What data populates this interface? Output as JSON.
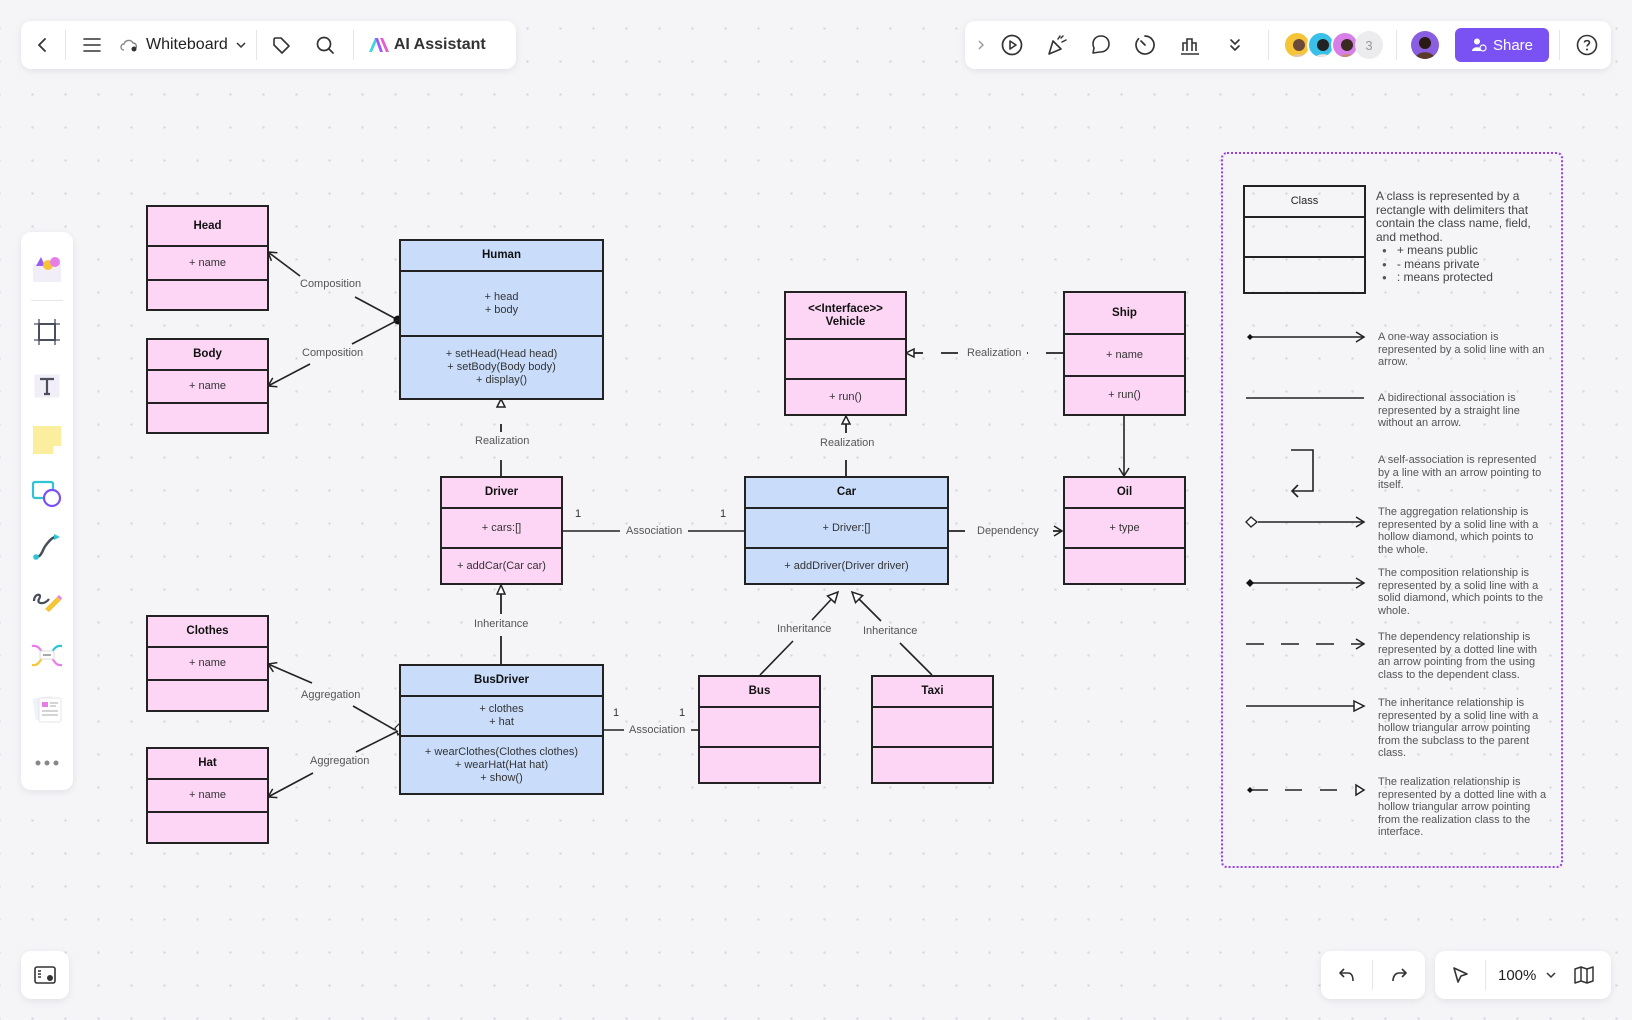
{
  "toolbar_left": {
    "back_icon": "chevron-left-icon",
    "menu_icon": "hamburger-icon",
    "cloud_icon": "cloud-icon",
    "title": "Whiteboard",
    "tag_icon": "tag-icon",
    "search_icon": "search-icon",
    "ai_label": "AI Assistant"
  },
  "toolbar_right": {
    "icons": [
      "chevron-right-icon",
      "play-icon",
      "celebrate-icon",
      "comment-icon",
      "timer-icon",
      "chart-icon",
      "double-chevron-down-icon"
    ],
    "collaborator_count": "3",
    "share_label": "Share",
    "help_icon": "help-icon"
  },
  "left_toolbar": {
    "items": [
      "templates",
      "frame",
      "text",
      "sticky-note",
      "shapes",
      "connector",
      "pen",
      "mindmap",
      "cards",
      "more"
    ]
  },
  "bottom": {
    "zoom_level": "100%"
  },
  "diagram": {
    "classes": {
      "head": {
        "name": "Head",
        "fields": [
          "+ name"
        ],
        "methods": []
      },
      "body": {
        "name": "Body",
        "fields": [
          "+ name"
        ],
        "methods": []
      },
      "human": {
        "name": "Human",
        "fields": [
          "+ head",
          "+ body"
        ],
        "methods": [
          "+ setHead(Head head)",
          "+ setBody(Body body)",
          "+ display()"
        ]
      },
      "driver": {
        "name": "Driver",
        "fields": [
          "+ cars:[]"
        ],
        "methods": [
          "+ addCar(Car car)"
        ]
      },
      "clothes": {
        "name": "Clothes",
        "fields": [
          "+ name"
        ],
        "methods": []
      },
      "hat": {
        "name": "Hat",
        "fields": [
          "+ name"
        ],
        "methods": []
      },
      "busdriver": {
        "name": "BusDriver",
        "fields": [
          "+ clothes",
          "+ hat"
        ],
        "methods": [
          "+ wearClothes(Clothes clothes)",
          "+ wearHat(Hat hat)",
          "+ show()"
        ]
      },
      "vehicle": {
        "name_line1": "<<Interface>>",
        "name_line2": "Vehicle",
        "fields": [],
        "methods": [
          "+ run()"
        ]
      },
      "car": {
        "name": "Car",
        "fields": [
          "+ Driver:[]"
        ],
        "methods": [
          "+ addDriver(Driver driver)"
        ]
      },
      "bus": {
        "name": "Bus",
        "fields": [],
        "methods": []
      },
      "taxi": {
        "name": "Taxi",
        "fields": [],
        "methods": []
      },
      "ship": {
        "name": "Ship",
        "fields": [
          "+ name"
        ],
        "methods": [
          "+ run()"
        ]
      },
      "oil": {
        "name": "Oil",
        "fields": [
          "+ type"
        ],
        "methods": []
      }
    },
    "labels": {
      "composition1": "Composition",
      "composition2": "Composition",
      "realization_human": "Realization",
      "association_driver_car": "Association",
      "inheritance_busdriver": "Inheritance",
      "aggregation1": "Aggregation",
      "aggregation2": "Aggregation",
      "association_busdriver_bus": "Association",
      "realization_car": "Realization",
      "realization_ship": "Realization",
      "dependency": "Dependency",
      "inheritance_bus": "Inheritance",
      "inheritance_taxi": "Inheritance"
    },
    "multiplicities": {
      "driver_side": "1",
      "car_side": "1",
      "busdriver_side": "1",
      "bus_side": "1"
    }
  },
  "legend": {
    "class_box_name": "Class",
    "class_text": "A class is represented by a rectangle with delimiters that contain the class name, field, and method.",
    "class_bullets": [
      "+ means public",
      "- means private",
      ": means protected"
    ],
    "items": [
      {
        "type": "one-way-association",
        "text": "A one-way association is represented by a solid line with an arrow."
      },
      {
        "type": "bidirectional-association",
        "text": "A bidirectional association is represented by a straight line without an arrow."
      },
      {
        "type": "self-association",
        "text": "A self-association is represented by a line with an arrow pointing to itself."
      },
      {
        "type": "aggregation",
        "text": "The aggregation relationship is represented by a solid line with a hollow diamond, which points to the whole."
      },
      {
        "type": "composition",
        "text": "The composition relationship is represented by a solid line with a solid diamond, which points to the whole."
      },
      {
        "type": "dependency",
        "text": "The dependency relationship is represented by a dotted line with an arrow pointing from the using class to the dependent class."
      },
      {
        "type": "inheritance",
        "text": "The inheritance relationship is represented by a solid line with a hollow triangular arrow pointing from the subclass to the parent class."
      },
      {
        "type": "realization",
        "text": "The realization relationship is represented by a dotted line with a hollow triangular arrow pointing from the realization class to the interface."
      }
    ]
  },
  "colors": {
    "accent": "#7a52f4",
    "class_pink": "#fdd6f6",
    "class_blue": "#c9ddfb",
    "legend_border": "#9b3ef0"
  }
}
